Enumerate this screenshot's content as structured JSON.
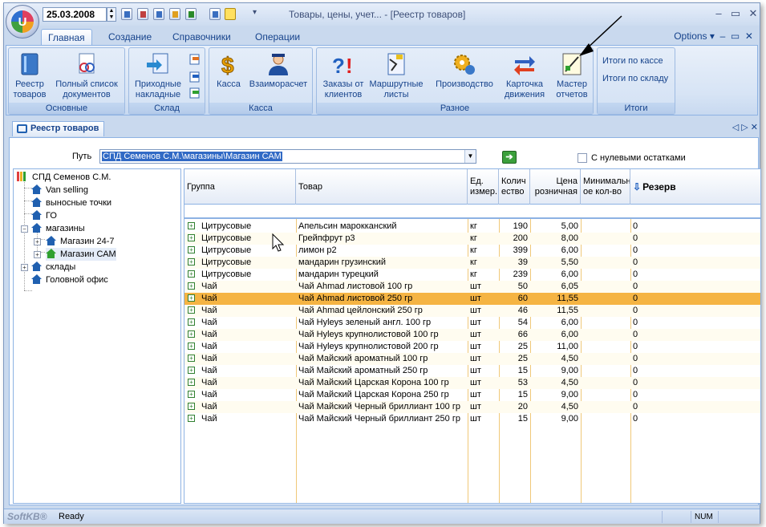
{
  "app": {
    "date": "25.03.2008",
    "window_title": "Товары, цены, учет... - [Реестр товаров]",
    "options_label": "Options"
  },
  "tabs": [
    "Главная",
    "Создание",
    "Справочники",
    "Операции"
  ],
  "ribbon": {
    "groups": {
      "basic": "Основные",
      "warehouse": "Склад",
      "cash": "Касса",
      "misc": "Разное",
      "totals": "Итоги"
    },
    "buttons": {
      "registry": [
        "Реестр",
        "товаров"
      ],
      "full_list": [
        "Полный список",
        "документов"
      ],
      "incoming": [
        "Приходные",
        "накладные"
      ],
      "cash": [
        "Касса"
      ],
      "settlements": [
        "Взаиморасчет"
      ],
      "client_orders": [
        "Заказы от",
        "клиентов"
      ],
      "route_sheets": [
        "Маршрутные",
        "листы"
      ],
      "production": [
        "Производство"
      ],
      "movement_card": [
        "Карточка",
        "движения"
      ],
      "report_wizard": [
        "Мастер",
        "отчетов"
      ]
    },
    "totals_items": [
      "Итоги по кассе",
      "Итоги по складу"
    ]
  },
  "doc_tab": "Реестр товаров",
  "path": {
    "label": "Путь",
    "value": "СПД Семенов С.М.\\магазины\\Магазин САМ"
  },
  "zero_stock_label": "С нулевыми остатками",
  "tree": [
    {
      "label": "СПД Семенов С.М."
    },
    {
      "label": "Van selling"
    },
    {
      "label": "выносные точки"
    },
    {
      "label": "ГО"
    },
    {
      "label": "магазины"
    },
    {
      "label": "Магазин 24-7"
    },
    {
      "label": "Магазин САМ"
    },
    {
      "label": "склады"
    },
    {
      "label": "Головной офис"
    }
  ],
  "grid": {
    "columns": {
      "group": "Группа",
      "item": "Товар",
      "unit": "Ед. измер.",
      "qty": "Колич ество",
      "price": "Цена розничная",
      "min_qty": "Минимальн ое кол-во",
      "reserve": "Резерв"
    },
    "rows": [
      [
        "Цитрусовые",
        "Апельсин марокканский",
        "кг",
        "190",
        "5,00",
        "",
        "0"
      ],
      [
        "Цитрусовые",
        "Грейпфрут р3",
        "кг",
        "200",
        "8,00",
        "",
        "0"
      ],
      [
        "Цитрусовые",
        "лимон р2",
        "кг",
        "399",
        "6,00",
        "",
        "0"
      ],
      [
        "Цитрусовые",
        "мандарин грузинский",
        "кг",
        "39",
        "5,50",
        "",
        "0"
      ],
      [
        "Цитрусовые",
        "мандарин турецкий",
        "кг",
        "239",
        "6,00",
        "",
        "0"
      ],
      [
        "Чай",
        "Чай Ahmad листовой 100 гр",
        "шт",
        "50",
        "6,05",
        "",
        "0"
      ],
      [
        "Чай",
        "Чай Ahmad листовой 250 гр",
        "шт",
        "60",
        "11,55",
        "",
        "0"
      ],
      [
        "Чай",
        "Чай Ahmad цейлонский 250 гр",
        "шт",
        "46",
        "11,55",
        "",
        "0"
      ],
      [
        "Чай",
        "Чай Hyleys зеленый англ. 100 гр",
        "шт",
        "54",
        "6,00",
        "",
        "0"
      ],
      [
        "Чай",
        "Чай Hyleys крупнолистовой 100 гр",
        "шт",
        "66",
        "6,00",
        "",
        "0"
      ],
      [
        "Чай",
        "Чай Hyleys крупнолистовой 200 гр",
        "шт",
        "25",
        "11,00",
        "",
        "0"
      ],
      [
        "Чай",
        "Чай Майский ароматный 100 гр",
        "шт",
        "25",
        "4,50",
        "",
        "0"
      ],
      [
        "Чай",
        "Чай Майский ароматный 250 гр",
        "шт",
        "15",
        "9,00",
        "",
        "0"
      ],
      [
        "Чай",
        "Чай Майский Царская Корона 100 гр",
        "шт",
        "53",
        "4,50",
        "",
        "0"
      ],
      [
        "Чай",
        "Чай Майский Царская Корона 250 гр",
        "шт",
        "15",
        "9,00",
        "",
        "0"
      ],
      [
        "Чай",
        "Чай Майский Черный бриллиант 100 гр",
        "шт",
        "20",
        "4,50",
        "",
        "0"
      ],
      [
        "Чай",
        "Чай Майский Черный бриллиант 250 гр",
        "шт",
        "15",
        "9,00",
        "",
        "0"
      ]
    ],
    "selected_row": 6
  },
  "status": {
    "brand": "SoftKB®",
    "text": "Ready",
    "num": "NUM"
  },
  "colors": {
    "selection": "#f5b443",
    "accent": "#15428b"
  }
}
